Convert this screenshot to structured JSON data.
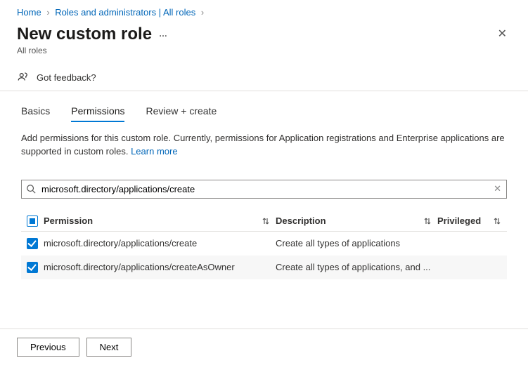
{
  "breadcrumb": {
    "home": "Home",
    "roles": "Roles and administrators | All roles"
  },
  "title": "New custom role",
  "subtitle": "All roles",
  "feedback": "Got feedback?",
  "tabs": {
    "basics": "Basics",
    "permissions": "Permissions",
    "review": "Review + create"
  },
  "description": "Add permissions for this custom role. Currently, permissions for Application registrations and Enterprise applications are supported in custom roles. ",
  "learn_more": "Learn more",
  "search": {
    "value": "microsoft.directory/applications/create"
  },
  "columns": {
    "permission": "Permission",
    "description": "Description",
    "privileged": "Privileged"
  },
  "rows": [
    {
      "permission": "microsoft.directory/applications/create",
      "description": "Create all types of applications"
    },
    {
      "permission": "microsoft.directory/applications/createAsOwner",
      "description": "Create all types of applications, and ..."
    }
  ],
  "buttons": {
    "previous": "Previous",
    "next": "Next"
  }
}
